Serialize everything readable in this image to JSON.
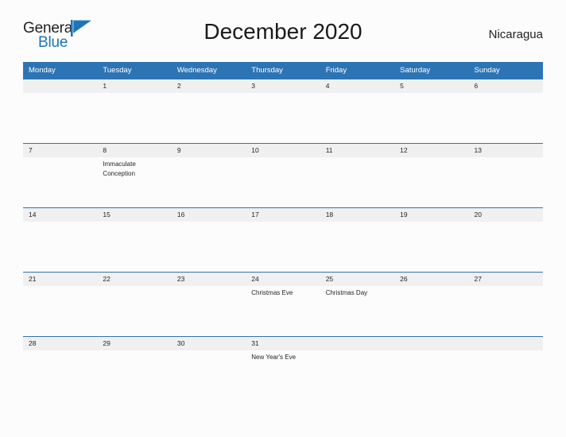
{
  "brand": {
    "name_part1": "General",
    "name_part2": "Blue",
    "flag_icon": "flag-triangle-icon",
    "color_dark": "#231f20",
    "color_blue": "#1b75bb"
  },
  "header": {
    "title": "December 2020",
    "country": "Nicaragua"
  },
  "theme": {
    "header_blue": "#2d74b5",
    "row_gray": "#f0f0f0",
    "page_background": "#fcfcfc",
    "text": "#231f20"
  },
  "calendar": {
    "month": "December",
    "year": "2020",
    "weekday_headers": [
      "Monday",
      "Tuesday",
      "Wednesday",
      "Thursday",
      "Friday",
      "Saturday",
      "Sunday"
    ],
    "weeks": [
      [
        {
          "day": "",
          "events": []
        },
        {
          "day": "1",
          "events": []
        },
        {
          "day": "2",
          "events": []
        },
        {
          "day": "3",
          "events": []
        },
        {
          "day": "4",
          "events": []
        },
        {
          "day": "5",
          "events": []
        },
        {
          "day": "6",
          "events": []
        }
      ],
      [
        {
          "day": "7",
          "events": []
        },
        {
          "day": "8",
          "events": [
            "Immaculate Conception"
          ]
        },
        {
          "day": "9",
          "events": []
        },
        {
          "day": "10",
          "events": []
        },
        {
          "day": "11",
          "events": []
        },
        {
          "day": "12",
          "events": []
        },
        {
          "day": "13",
          "events": []
        }
      ],
      [
        {
          "day": "14",
          "events": []
        },
        {
          "day": "15",
          "events": []
        },
        {
          "day": "16",
          "events": []
        },
        {
          "day": "17",
          "events": []
        },
        {
          "day": "18",
          "events": []
        },
        {
          "day": "19",
          "events": []
        },
        {
          "day": "20",
          "events": []
        }
      ],
      [
        {
          "day": "21",
          "events": []
        },
        {
          "day": "22",
          "events": []
        },
        {
          "day": "23",
          "events": []
        },
        {
          "day": "24",
          "events": [
            "Christmas Eve"
          ]
        },
        {
          "day": "25",
          "events": [
            "Christmas Day"
          ]
        },
        {
          "day": "26",
          "events": []
        },
        {
          "day": "27",
          "events": []
        }
      ],
      [
        {
          "day": "28",
          "events": []
        },
        {
          "day": "29",
          "events": []
        },
        {
          "day": "30",
          "events": []
        },
        {
          "day": "31",
          "events": [
            "New Year's Eve"
          ]
        },
        {
          "day": "",
          "events": []
        },
        {
          "day": "",
          "events": []
        },
        {
          "day": "",
          "events": []
        }
      ]
    ]
  }
}
